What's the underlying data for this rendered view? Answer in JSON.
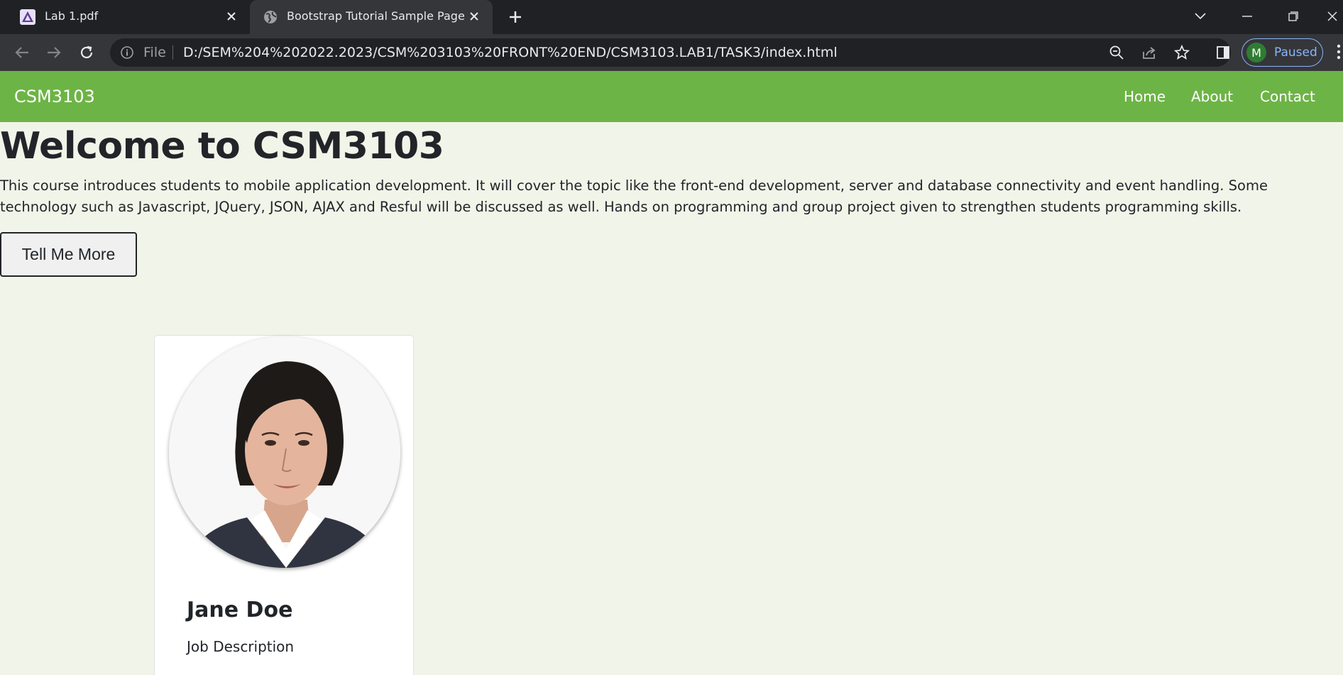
{
  "browser": {
    "tabs": [
      {
        "title": "Lab 1.pdf",
        "favicon": "pdf-app-icon",
        "active": false
      },
      {
        "title": "Bootstrap Tutorial Sample Page",
        "favicon": "globe-icon",
        "active": true
      }
    ],
    "omnibox": {
      "scheme_label": "File",
      "url": "D:/SEM%204%202022.2023/CSM%203103%20FRONT%20END/CSM3103.LAB1/TASK3/index.html"
    },
    "profile": {
      "initial": "M",
      "status": "Paused"
    }
  },
  "page": {
    "navbar": {
      "brand": "CSM3103",
      "links": [
        "Home",
        "About",
        "Contact"
      ],
      "bg_color": "#6db446"
    },
    "heading": "Welcome to CSM3103",
    "intro": "This course introduces students to mobile application development. It will cover the topic like the front-end development, server and database connectivity and event handling. Some technology such as Javascript, JQuery, JSON, AJAX and Resful will be discussed as well. Hands on programming and group project given to strengthen students programming skills.",
    "cta_label": "Tell Me More",
    "card": {
      "name": "Jane Doe",
      "description": "Job Description"
    },
    "background_color": "#f1f4e8"
  }
}
